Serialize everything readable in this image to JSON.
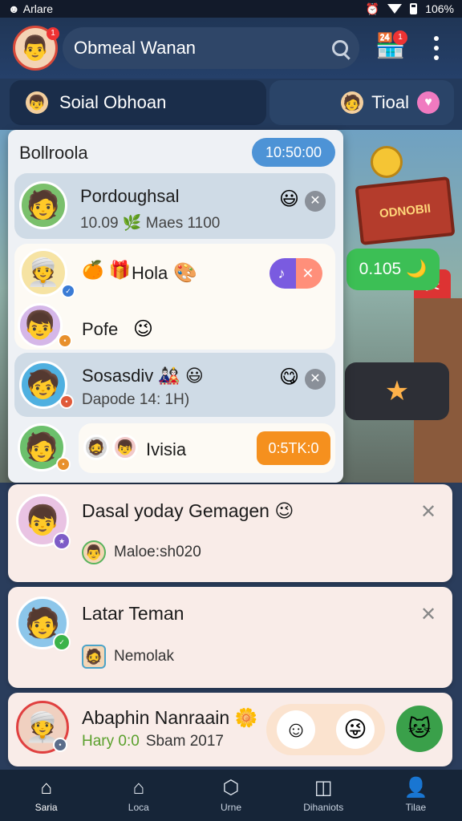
{
  "status_bar": {
    "left_text": "Arlare",
    "battery": "106%"
  },
  "header": {
    "profile_badge": "1",
    "search_value": "Obmeal Wanan",
    "store_badge": "1"
  },
  "subrow": {
    "left_label": "Soial Obhoan",
    "right_label": "Tioal"
  },
  "game": {
    "sign_text": "ODNOBII",
    "green_value": "0.105",
    "green_icon": "🌙"
  },
  "popup": {
    "title": "Bollroola",
    "time": "10:50:00",
    "rows": [
      {
        "name": "Pordoughsal",
        "sub": "10.09 🌿 Maes 1100",
        "emoji": "😃"
      },
      {
        "name": "Hola",
        "prefix": "🍊 🎁",
        "emoji": "🎨"
      },
      {
        "name": "Pofe",
        "emoji": "😉"
      },
      {
        "name": "Sosasdiv 🎎 😃",
        "sub": "Dapode 14: 1H)",
        "emoji": "😋"
      },
      {
        "name": "Ivisia",
        "button": "0:5TK:0"
      }
    ]
  },
  "notifications": [
    {
      "title": "Dasal yoday Gemagen 😉",
      "sub": "Maloe:sh020"
    },
    {
      "title": "Latar Teman",
      "sub": "Nemolak"
    },
    {
      "title": "Abaphin Nanraain 🌼",
      "sub_highlight": "Hary 0:0",
      "sub": "Sbam 2017"
    }
  ],
  "bottom_nav": [
    {
      "label": "Saria",
      "icon": "home-icon"
    },
    {
      "label": "Loca",
      "icon": "house-outline-icon"
    },
    {
      "label": "Urne",
      "icon": "cube-icon"
    },
    {
      "label": "Dihaniots",
      "icon": "chart-icon"
    },
    {
      "label": "Tilae",
      "icon": "person-icon"
    }
  ]
}
